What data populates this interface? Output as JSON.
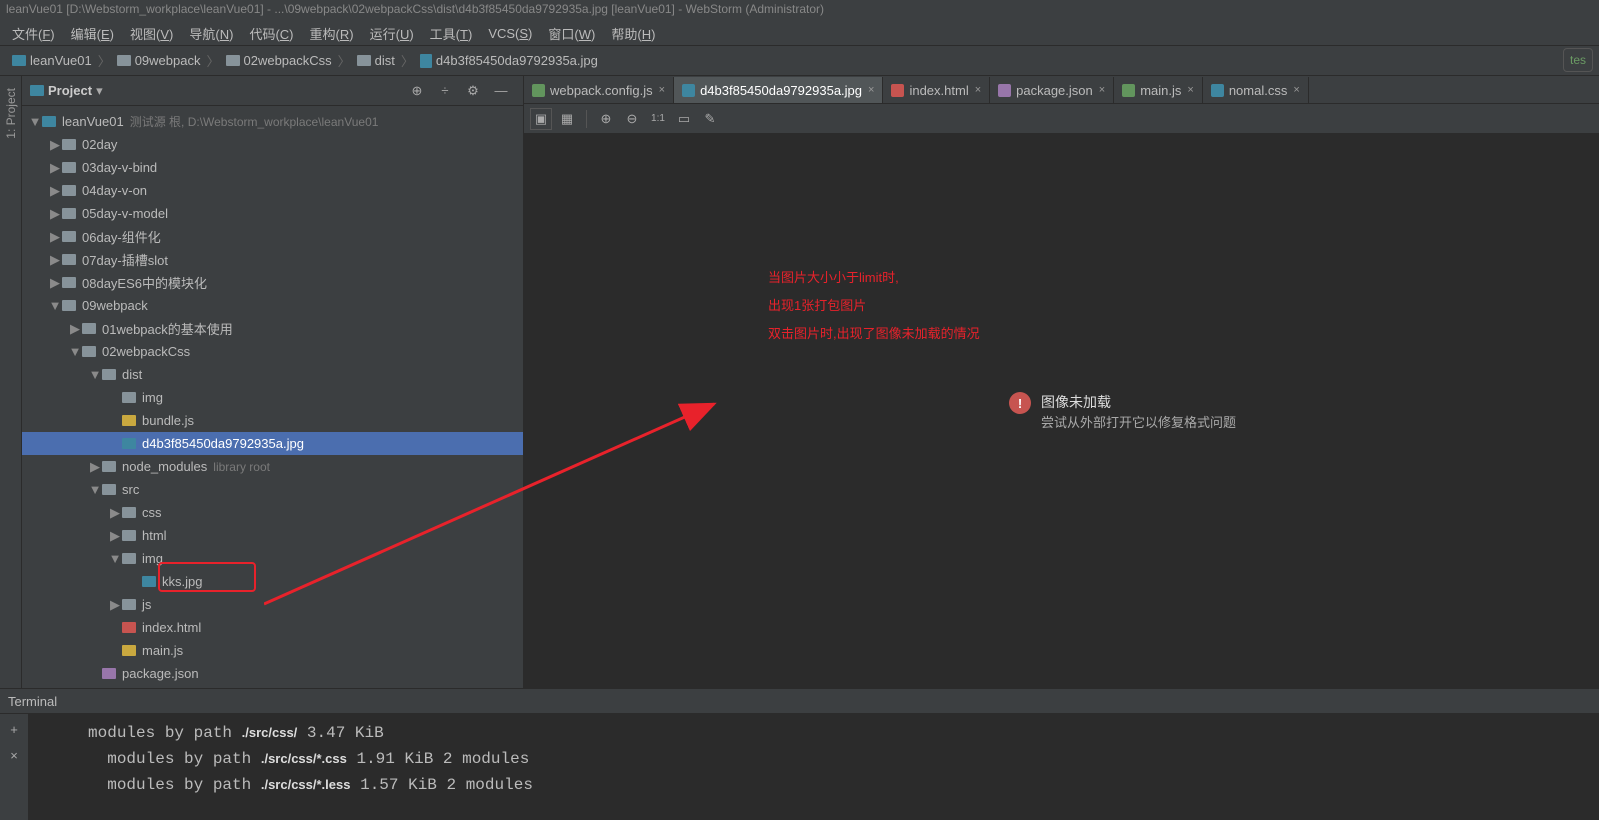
{
  "title": "leanVue01 [D:\\Webstorm_workplace\\leanVue01] - ...\\09webpack\\02webpackCss\\dist\\d4b3f85450da9792935a.jpg [leanVue01] - WebStorm (Administrator)",
  "menu": [
    "文件(F)",
    "编辑(E)",
    "视图(V)",
    "导航(N)",
    "代码(C)",
    "重构(R)",
    "运行(U)",
    "工具(T)",
    "VCS(S)",
    "窗口(W)",
    "帮助(H)"
  ],
  "breadcrumbs": [
    "leanVue01",
    "09webpack",
    "02webpackCss",
    "dist",
    "d4b3f85450da9792935a.jpg"
  ],
  "runBadge": "tes",
  "sidebar": {
    "title": "Project",
    "projectLabel": "1: Project",
    "rows": [
      {
        "d": 0,
        "ar": "▼",
        "ic": "teal",
        "t": "leanVue01",
        "dim": "测试源 根, D:\\Webstorm_workplace\\leanVue01"
      },
      {
        "d": 1,
        "ar": "▶",
        "ic": "fold",
        "t": "02day"
      },
      {
        "d": 1,
        "ar": "▶",
        "ic": "fold",
        "t": "03day-v-bind"
      },
      {
        "d": 1,
        "ar": "▶",
        "ic": "fold",
        "t": "04day-v-on"
      },
      {
        "d": 1,
        "ar": "▶",
        "ic": "fold",
        "t": "05day-v-model"
      },
      {
        "d": 1,
        "ar": "▶",
        "ic": "fold",
        "t": "06day-组件化"
      },
      {
        "d": 1,
        "ar": "▶",
        "ic": "fold",
        "t": "07day-插槽slot"
      },
      {
        "d": 1,
        "ar": "▶",
        "ic": "fold",
        "t": "08dayES6中的模块化"
      },
      {
        "d": 1,
        "ar": "▼",
        "ic": "fold",
        "t": "09webpack"
      },
      {
        "d": 2,
        "ar": "▶",
        "ic": "fold",
        "t": "01webpack的基本使用"
      },
      {
        "d": 2,
        "ar": "▼",
        "ic": "fold",
        "t": "02webpackCss"
      },
      {
        "d": 3,
        "ar": "▼",
        "ic": "fold",
        "t": "dist"
      },
      {
        "d": 4,
        "ar": "",
        "ic": "fold",
        "t": "img"
      },
      {
        "d": 4,
        "ar": "",
        "ic": "js",
        "t": "bundle.js"
      },
      {
        "d": 4,
        "ar": "",
        "ic": "img",
        "t": "d4b3f85450da9792935a.jpg",
        "sel": true
      },
      {
        "d": 3,
        "ar": "▶",
        "ic": "fold",
        "t": "node_modules",
        "dim": "library root"
      },
      {
        "d": 3,
        "ar": "▼",
        "ic": "fold",
        "t": "src"
      },
      {
        "d": 4,
        "ar": "▶",
        "ic": "fold",
        "t": "css"
      },
      {
        "d": 4,
        "ar": "▶",
        "ic": "fold",
        "t": "html"
      },
      {
        "d": 4,
        "ar": "▼",
        "ic": "fold",
        "t": "img"
      },
      {
        "d": 5,
        "ar": "",
        "ic": "img",
        "t": "kks.jpg",
        "hl": true
      },
      {
        "d": 4,
        "ar": "▶",
        "ic": "fold",
        "t": "js"
      },
      {
        "d": 4,
        "ar": "",
        "ic": "html",
        "t": "index.html"
      },
      {
        "d": 4,
        "ar": "",
        "ic": "js",
        "t": "main.js"
      },
      {
        "d": 3,
        "ar": "",
        "ic": "json",
        "t": "package.json"
      }
    ]
  },
  "tabs": [
    {
      "t": "webpack.config.js",
      "ic": "js"
    },
    {
      "t": "d4b3f85450da9792935a.jpg",
      "ic": "img",
      "active": true
    },
    {
      "t": "index.html",
      "ic": "html"
    },
    {
      "t": "package.json",
      "ic": "json"
    },
    {
      "t": "main.js",
      "ic": "js"
    },
    {
      "t": "nomal.css",
      "ic": "css"
    }
  ],
  "annotation": {
    "l1": "当图片大小小于limit时,",
    "l2": "出现1张打包图片",
    "l3": "双击图片时,出现了图像未加载的情况"
  },
  "error": {
    "title": "图像未加载",
    "detail": "尝试从外部打开它以修复格式问题"
  },
  "terminal": {
    "title": "Terminal",
    "lines": [
      {
        "pre": "     modules by path ",
        "bold": "./src/css/",
        "post": " 3.47 KiB"
      },
      {
        "pre": "       modules by path ",
        "bold": "./src/css/*.css",
        "post": " 1.91 KiB 2 modules"
      },
      {
        "pre": "       modules by path ",
        "bold": "./src/css/*.less",
        "post": " 1.57 KiB 2 modules"
      }
    ]
  }
}
